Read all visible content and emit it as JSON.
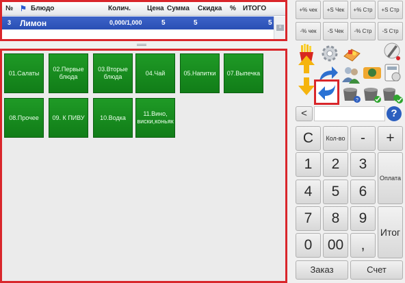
{
  "order_table": {
    "headers": [
      "№",
      "Блюдо",
      "Колич.",
      "Цена",
      "Сумма",
      "Скидка",
      "%",
      "ИТОГО"
    ],
    "rows": [
      {
        "no": "3",
        "dish": "Лимон",
        "qty": "0,000/1,000",
        "price": "5",
        "sum": "5",
        "discount": "",
        "percent": "",
        "total": "5"
      }
    ]
  },
  "menu": {
    "categories": [
      {
        "label": "01.Салаты"
      },
      {
        "label": "02.Первые блюда"
      },
      {
        "label": "03.Вторые блюда"
      },
      {
        "label": "04.Чай"
      },
      {
        "label": "05.Напитки"
      },
      {
        "label": "07.Выпечка"
      },
      {
        "label": "08.Прочее"
      },
      {
        "label": "09. К ПИВУ"
      },
      {
        "label": "10.Водка"
      },
      {
        "label": "11.Вино, виски,коньяк"
      }
    ],
    "category_color": "#1a8f21"
  },
  "discounts": [
    {
      "label": "+% чек"
    },
    {
      "label": "+S Чек"
    },
    {
      "label": "+% Стр"
    },
    {
      "label": "+S Стр"
    },
    {
      "label": "-% чек"
    },
    {
      "label": "-S Чек"
    },
    {
      "label": "-% Стр"
    },
    {
      "label": "-S Стр"
    }
  ],
  "tools": {
    "icons": [
      "fries-icon",
      "gear-icon",
      "tray-icon",
      "pen-icon",
      "up-down-arrows-icon",
      "redo-arrow-icon",
      "users-icon",
      "camera-icon",
      "calculator-icon",
      "back-arrow-icon",
      "cup-help-icon",
      "cup-check-icon",
      "cup-check-all-icon"
    ],
    "back_label": "<",
    "help_label": "?"
  },
  "keypad": {
    "clear": "C",
    "qty": "Кол-во",
    "minus": "-",
    "plus": "+",
    "digits": [
      "1",
      "2",
      "3",
      "4",
      "5",
      "6",
      "7",
      "8",
      "9",
      "0",
      "00"
    ],
    "comma": ",",
    "pay": "Оплата",
    "total": "Итог",
    "order": "Заказ",
    "bill": "Счет"
  },
  "colors": {
    "highlight": "#d9262b",
    "selected_row": "#2f55bc",
    "category": "#1a8f21"
  }
}
